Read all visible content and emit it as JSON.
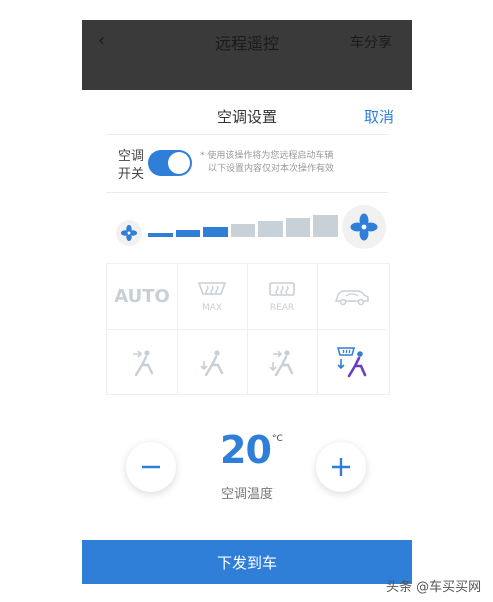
{
  "topbar": {
    "back_glyph": "‹",
    "title": "远程遥控",
    "share_label": "车分享"
  },
  "sheet": {
    "title": "空调设置",
    "cancel_label": "取消"
  },
  "ac_switch": {
    "label_line1": "空调",
    "label_line2": "开关",
    "on": true,
    "note_line1": "* 使用该操作将为您远程启动车辆",
    "note_line2": "以下设置内容仅对本次操作有效"
  },
  "fan": {
    "level_steps": 7,
    "active_steps": 3,
    "active_color": "#2f7fd8",
    "inactive_color": "#c8d0d8"
  },
  "modes": {
    "row1": [
      {
        "name": "auto-mode",
        "label": "AUTO",
        "selected": false
      },
      {
        "name": "defrost-max-mode",
        "label": "MAX",
        "selected": false
      },
      {
        "name": "defrost-rear-mode",
        "label": "REAR",
        "selected": false
      },
      {
        "name": "recirculation-mode",
        "label": "",
        "selected": false
      }
    ],
    "row2": [
      {
        "name": "airflow-face-mode",
        "selected": false
      },
      {
        "name": "airflow-feet-mode",
        "selected": false
      },
      {
        "name": "airflow-face-feet-mode",
        "selected": false
      },
      {
        "name": "airflow-windshield-feet-mode",
        "selected": true
      }
    ]
  },
  "temperature": {
    "value": "20",
    "unit": "°C",
    "label": "空调温度"
  },
  "actions": {
    "send_label": "下发到车"
  },
  "watermark": "头条 @车买买网",
  "colors": {
    "accent": "#2f7fd8",
    "icon_inactive": "#c9cfd6"
  }
}
